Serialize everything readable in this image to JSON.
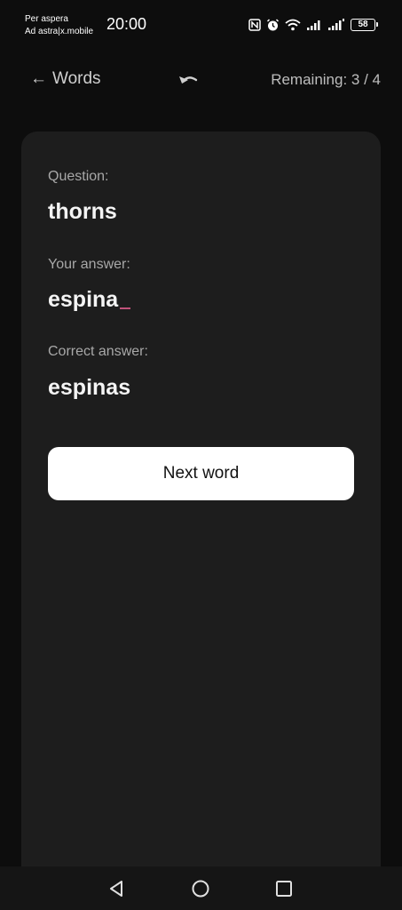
{
  "status_bar": {
    "carrier_line1": "Per aspera",
    "carrier_line2": "Ad astra|x.mobile",
    "time": "20:00",
    "battery": "58",
    "icons": [
      "nfc-icon",
      "alarm-icon",
      "wifi-icon",
      "signal-icon",
      "signal-icon",
      "battery-icon"
    ]
  },
  "header": {
    "back_arrow": "←",
    "back_label": "Words",
    "undo_icon": "undo-icon",
    "remaining": "Remaining: 3 / 4"
  },
  "quiz": {
    "question_label": "Question:",
    "question": "thorns",
    "your_answer_label": "Your answer:",
    "your_answer": "espina",
    "correct_answer_label": "Correct answer:",
    "correct_answer": "espinas",
    "next_button": "Next word"
  },
  "nav_bar": {
    "buttons": [
      "back-triangle-icon",
      "home-circle-icon",
      "recents-square-icon"
    ]
  },
  "colors": {
    "background": "#0d0d0d",
    "card": "#1d1d1d",
    "button": "#ffffff",
    "caret": "#c0537a"
  }
}
